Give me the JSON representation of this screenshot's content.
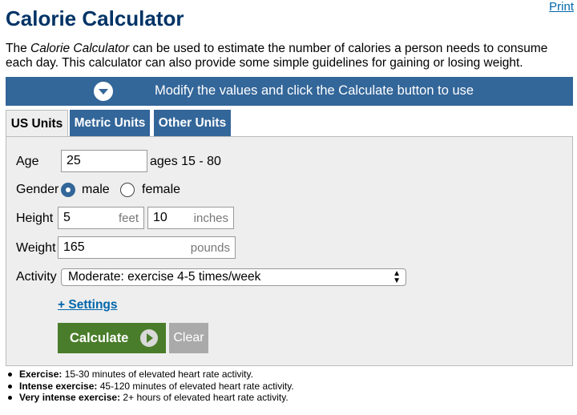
{
  "header": {
    "title": "Calorie Calculator",
    "print_label": "Print"
  },
  "intro": {
    "prefix": "The ",
    "name": "Calorie Calculator",
    "text": " can be used to estimate the number of calories a person needs to consume each day. This calculator can also provide some simple guidelines for gaining or losing weight."
  },
  "banner": {
    "text": "Modify the values and click the Calculate button to use",
    "icon": "chevron-down-circle-icon"
  },
  "tabs": [
    {
      "label": "US Units",
      "active": true
    },
    {
      "label": "Metric Units",
      "active": false
    },
    {
      "label": "Other Units",
      "active": false
    }
  ],
  "form": {
    "age": {
      "label": "Age",
      "value": "25",
      "hint": "ages 15 - 80"
    },
    "gender": {
      "label": "Gender",
      "options": [
        {
          "label": "male",
          "checked": true
        },
        {
          "label": "female",
          "checked": false
        }
      ]
    },
    "height": {
      "label": "Height",
      "feet_value": "5",
      "feet_unit": "feet",
      "inches_value": "10",
      "inches_unit": "inches"
    },
    "weight": {
      "label": "Weight",
      "value": "165",
      "unit": "pounds"
    },
    "activity": {
      "label": "Activity",
      "selected": "Moderate: exercise 4-5 times/week"
    },
    "settings_label": "+ Settings",
    "calculate_label": "Calculate",
    "clear_label": "Clear"
  },
  "notes": [
    {
      "term": "Exercise:",
      "text": " 15-30 minutes of elevated heart rate activity."
    },
    {
      "term": "Intense exercise:",
      "text": " 45-120 minutes of elevated heart rate activity."
    },
    {
      "term": "Very intense exercise:",
      "text": " 2+ hours of elevated heart rate activity."
    }
  ],
  "colors": {
    "title": "#003366",
    "banner": "#336699",
    "link": "#0066aa",
    "calculate_button": "#4a7d2b",
    "clear_button": "#aaaaaa",
    "panel": "#eeeeee"
  }
}
